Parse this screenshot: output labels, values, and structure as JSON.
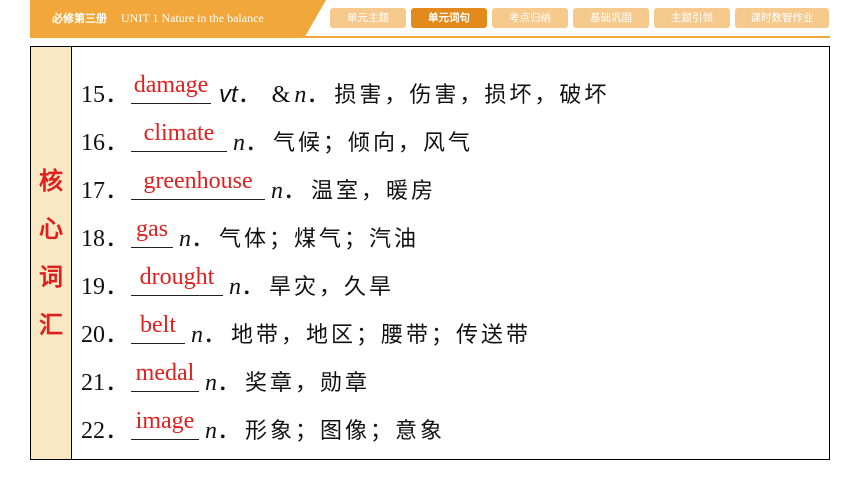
{
  "header": {
    "book": "必修第三册",
    "unit": "UNIT 1    Nature in the balance",
    "tabs": [
      {
        "label": "单元主题",
        "active": false
      },
      {
        "label": "单元词句",
        "active": true
      },
      {
        "label": "考点归纳",
        "active": false
      },
      {
        "label": "基础巩固",
        "active": false
      },
      {
        "label": "主题引领",
        "active": false
      },
      {
        "label": "课时数智作业",
        "active": false
      }
    ]
  },
  "section_label": [
    "核",
    "心",
    "词",
    "汇"
  ],
  "entries": [
    {
      "num": "15．",
      "answer": "damage",
      "pos": "vt",
      "pos2": "n",
      "definition": "损害，伤害，损坏，破坏"
    },
    {
      "num": "16．",
      "answer": "climate",
      "pos": "n",
      "definition": "气候；倾向，风气"
    },
    {
      "num": "17．",
      "answer": "greenhouse",
      "pos": "n",
      "definition": "温室，暖房"
    },
    {
      "num": "18．",
      "answer": "gas",
      "pos": "n",
      "definition": "气体；煤气；汽油"
    },
    {
      "num": "19．",
      "answer": "drought",
      "pos": "n",
      "definition": "旱灾，久旱"
    },
    {
      "num": "20．",
      "answer": "belt",
      "pos": "n",
      "definition": "地带，地区；腰带；传送带"
    },
    {
      "num": "21．",
      "answer": "medal",
      "pos": "n",
      "definition": "奖章，勋章"
    },
    {
      "num": "22．",
      "answer": "image",
      "pos": "n",
      "definition": "形象；图像；意象"
    }
  ],
  "colors": {
    "accent": "#f1a73a",
    "answer": "#e11f1f",
    "side_bg": "#f8e8c4"
  }
}
